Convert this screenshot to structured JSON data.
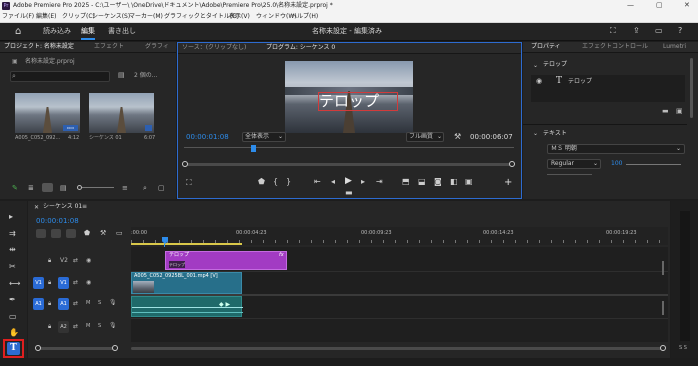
{
  "window": {
    "app_title": "Adobe Premiere Pro 2025 - C:\\ユーザー\\       \\OneDrive\\ドキュメント\\Adobe\\Premiere Pro\\25.0\\名称未設定.prproj *",
    "min": "—",
    "max": "▢",
    "close": "✕"
  },
  "menu": [
    "ファイル(F)",
    "編集(E)",
    "クリップ(C)",
    "シーケンス(S)",
    "マーカー(M)",
    "グラフィックとタイトル(G)",
    "表示(V)",
    "ウィンドウ(W)",
    "ヘルプ(H)"
  ],
  "workspace": {
    "tabs": [
      "読み込み",
      "編集",
      "書き出し"
    ],
    "title": "名称未設定 - 編集済み"
  },
  "project": {
    "tabs": [
      "プロジェクト: 名称未設定",
      "エフェクト",
      "グラフィ"
    ],
    "file": "名称未設定.prproj",
    "count": "2 個の...",
    "clips": [
      {
        "name": "A005_C052_092...",
        "dur": "4:12"
      },
      {
        "name": "シーケンス 01",
        "dur": "6:07"
      }
    ]
  },
  "monitor": {
    "tabs": [
      "ソース：(クリップなし)",
      "プログラム: シーケンス 0"
    ],
    "overlay_text": "テロップ",
    "timecode": "00:00:01:08",
    "fit": "全体表示",
    "quality": "フル画質",
    "duration": "00:00:06:07"
  },
  "effects": {
    "tabs": [
      "プロパティ",
      "エフェクトコントロール",
      "Lumetri"
    ],
    "telop_header": "テロップ",
    "telop_layer": "テロップ",
    "text_header": "テキスト",
    "font": "ＭＳ 明朝",
    "style": "Regular",
    "size": "100"
  },
  "timeline": {
    "tab": "シーケンス 01",
    "timecode": "00:00:01:08",
    "ruler": [
      ":00:00",
      "00:00:04:23",
      "00:00:09:23",
      "00:00:14:23",
      "00:00:19:23"
    ],
    "tracks": {
      "v2": "V2",
      "v1": "V1",
      "a1": "A1",
      "a2": "A2",
      "v1src": "V1",
      "a1src": "A1"
    },
    "clip_title": "テロップ",
    "clip_video": "A005_C052_0925BL_001.mp4 [V]",
    "fx": "fx"
  },
  "meter": {
    "label": "S S"
  }
}
